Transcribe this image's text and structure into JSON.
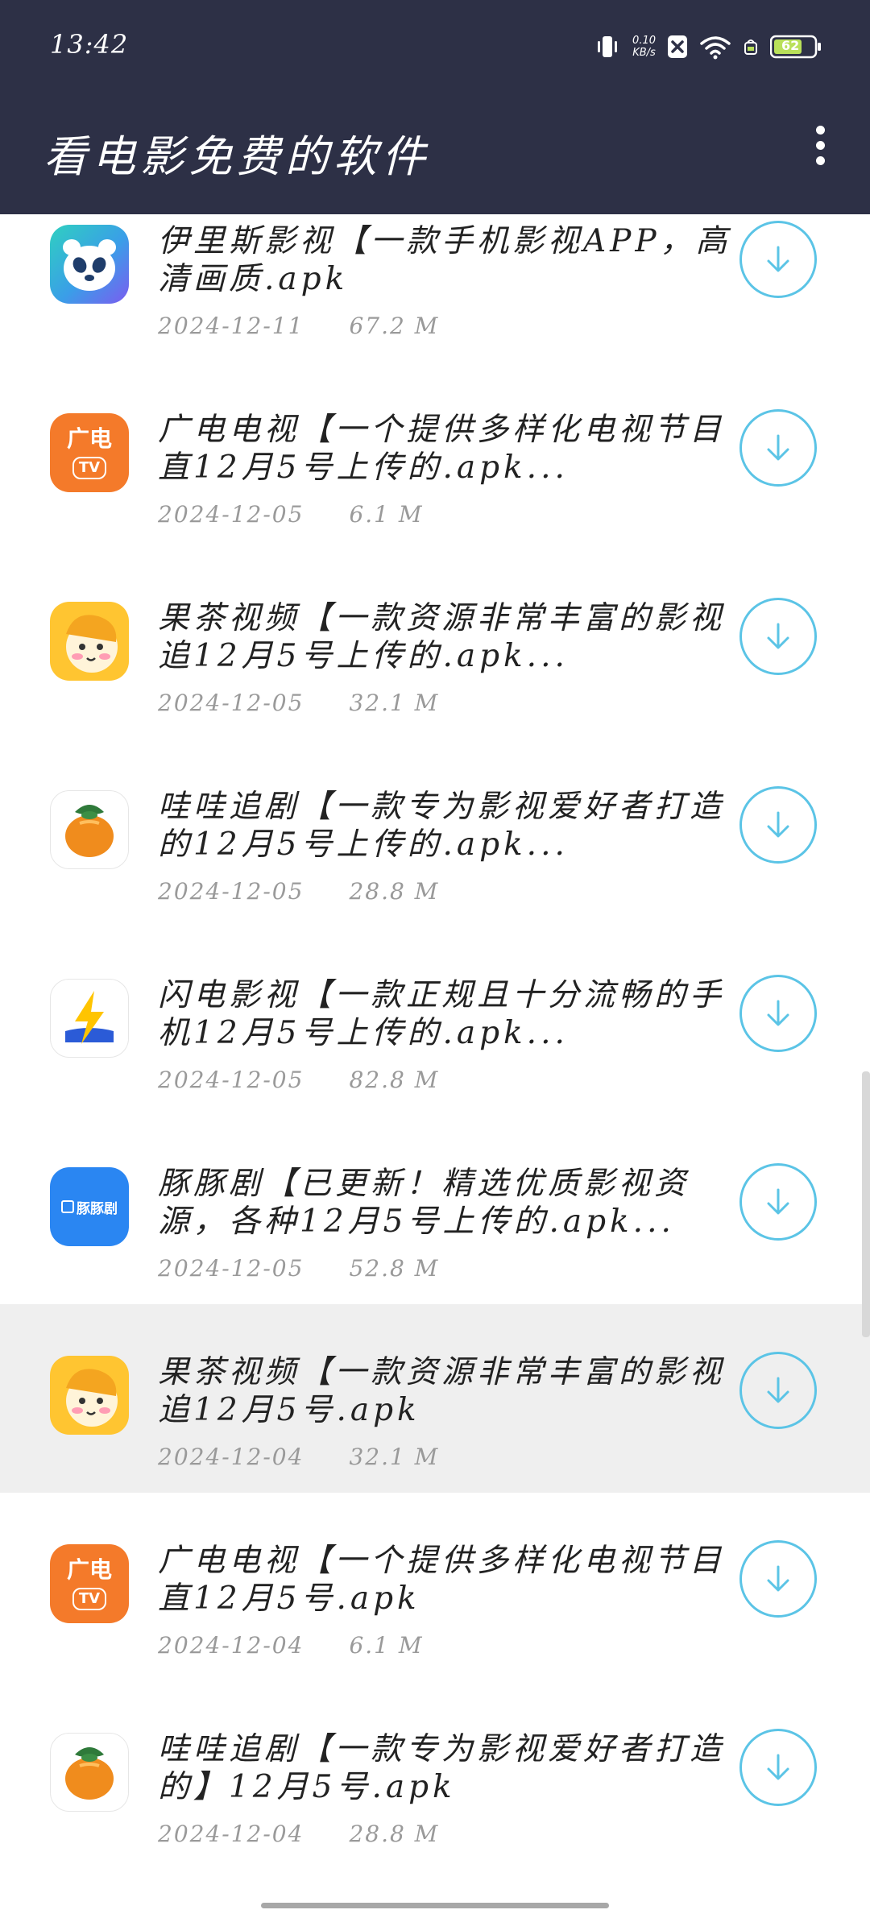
{
  "status_bar": {
    "time": "13:42",
    "net_speed_value": "0.10",
    "net_speed_unit": "KB/s",
    "battery": "62"
  },
  "header": {
    "title": "看电影免费的软件"
  },
  "items": [
    {
      "title": "伊里斯影视【一款手机影视APP，高清画质.apk",
      "date": "2024-12-11",
      "size": "67.2 M",
      "icon": "panda-icon"
    },
    {
      "title": "广电电视【一个提供多样化电视节目直12月5号上传的.apk...",
      "date": "2024-12-05",
      "size": "6.1 M",
      "icon": "guangdian-tv-icon",
      "icon_text_top": "广电",
      "icon_text_bottom": "TV"
    },
    {
      "title": "果茶视频【一款资源非常丰富的影视追12月5号上传的.apk...",
      "date": "2024-12-05",
      "size": "32.1 M",
      "icon": "cartoon-face-icon"
    },
    {
      "title": "哇哇追剧【一款专为影视爱好者打造的12月5号上传的.apk...",
      "date": "2024-12-05",
      "size": "28.8 M",
      "icon": "orange-fruit-icon"
    },
    {
      "title": "闪电影视【一款正规且十分流畅的手机12月5号上传的.apk...",
      "date": "2024-12-05",
      "size": "82.8 M",
      "icon": "lightning-icon"
    },
    {
      "title": "豚豚剧【已更新！精选优质影视资源，各种12月5号上传的.apk...",
      "date": "2024-12-05",
      "size": "52.8 M",
      "icon": "tuntunju-icon",
      "icon_text": "豚豚剧"
    },
    {
      "title": "果茶视频【一款资源非常丰富的影视追12月5号.apk",
      "date": "2024-12-04",
      "size": "32.1 M",
      "icon": "cartoon-face-icon",
      "selected": true
    },
    {
      "title": "广电电视【一个提供多样化电视节目直12月5号.apk",
      "date": "2024-12-04",
      "size": "6.1 M",
      "icon": "guangdian-tv-icon",
      "icon_text_top": "广电",
      "icon_text_bottom": "TV"
    },
    {
      "title": "哇哇追剧【一款专为影视爱好者打造的】12月5号.apk",
      "date": "2024-12-04",
      "size": "28.8 M",
      "icon": "orange-fruit-icon"
    }
  ],
  "colors": {
    "header_bg": "#2d3046",
    "download_accent": "#5bc4e6",
    "selected_row": "#efefef"
  }
}
